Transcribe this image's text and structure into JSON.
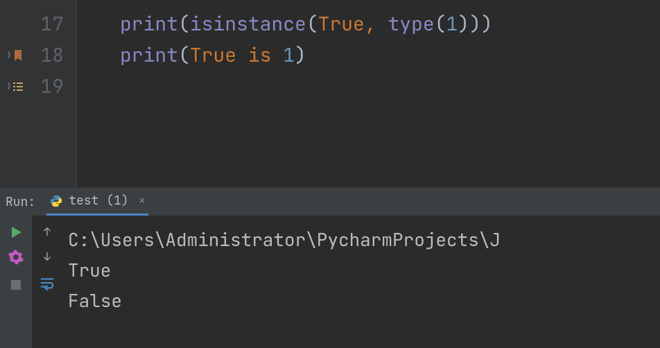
{
  "editor": {
    "lines": [
      {
        "number": "17",
        "tokens": [
          {
            "t": "print",
            "c": "kw-builtin"
          },
          {
            "t": "(",
            "c": "paren"
          },
          {
            "t": "isinstance",
            "c": "kw-builtin"
          },
          {
            "t": "(",
            "c": "paren"
          },
          {
            "t": "True",
            "c": "kw-literal"
          },
          {
            "t": ", ",
            "c": "comma"
          },
          {
            "t": "type",
            "c": "kw-builtin"
          },
          {
            "t": "(",
            "c": "paren"
          },
          {
            "t": "1",
            "c": "kw-number"
          },
          {
            "t": ")))",
            "c": "paren"
          }
        ],
        "gutter": null
      },
      {
        "number": "18",
        "tokens": [
          {
            "t": "print",
            "c": "kw-builtin"
          },
          {
            "t": "(",
            "c": "paren"
          },
          {
            "t": "True",
            "c": "kw-literal"
          },
          {
            "t": " is ",
            "c": "kw-literal"
          },
          {
            "t": "1",
            "c": "kw-number"
          },
          {
            "t": ")",
            "c": "paren"
          }
        ],
        "gutter": "bookmark"
      },
      {
        "number": "19",
        "tokens": [],
        "gutter": "list"
      }
    ]
  },
  "run": {
    "label": "Run:",
    "tab_title": "test (1)",
    "output": [
      "C:\\Users\\Administrator\\PycharmProjects\\J",
      "True",
      "False"
    ]
  }
}
